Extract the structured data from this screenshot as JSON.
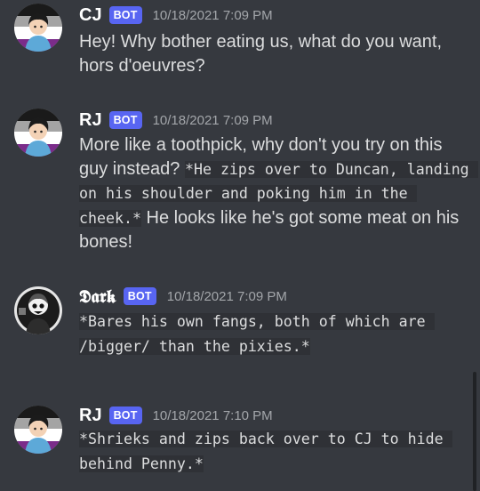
{
  "messages": [
    {
      "author": "CJ",
      "badge": "BOT",
      "timestamp": "10/18/2021 7:09 PM",
      "text_before": "Hey! Why bother eating us, what do you want, hors d'oeuvres?",
      "code": "",
      "text_after": ""
    },
    {
      "author": "RJ",
      "badge": "BOT",
      "timestamp": "10/18/2021 7:09 PM",
      "text_before": "More like a toothpick, why don't you try on this guy instead? ",
      "code": "*He zips over to Duncan, landing on his shoulder and poking him in the cheek.*",
      "text_after": " He looks like he's got some meat on his bones!"
    },
    {
      "author": "𝕯𝖆𝖗𝖐",
      "badge": "BOT",
      "timestamp": "10/18/2021 7:09 PM",
      "text_before": "",
      "code": "*Bares his own fangs, both of which are /bigger/ than the pixies.*",
      "text_after": ""
    },
    {
      "author": "RJ",
      "badge": "BOT",
      "timestamp": "10/18/2021 7:10 PM",
      "text_before": "",
      "code": "*Shrieks and zips back over to CJ to hide behind Penny.*",
      "text_after": ""
    }
  ],
  "colors": {
    "background": "#36393f",
    "bot_badge": "#5865f2",
    "username": "#ffffff",
    "message_text": "#dcddde",
    "timestamp": "#a3a6aa",
    "code_background": "#2f3136"
  }
}
